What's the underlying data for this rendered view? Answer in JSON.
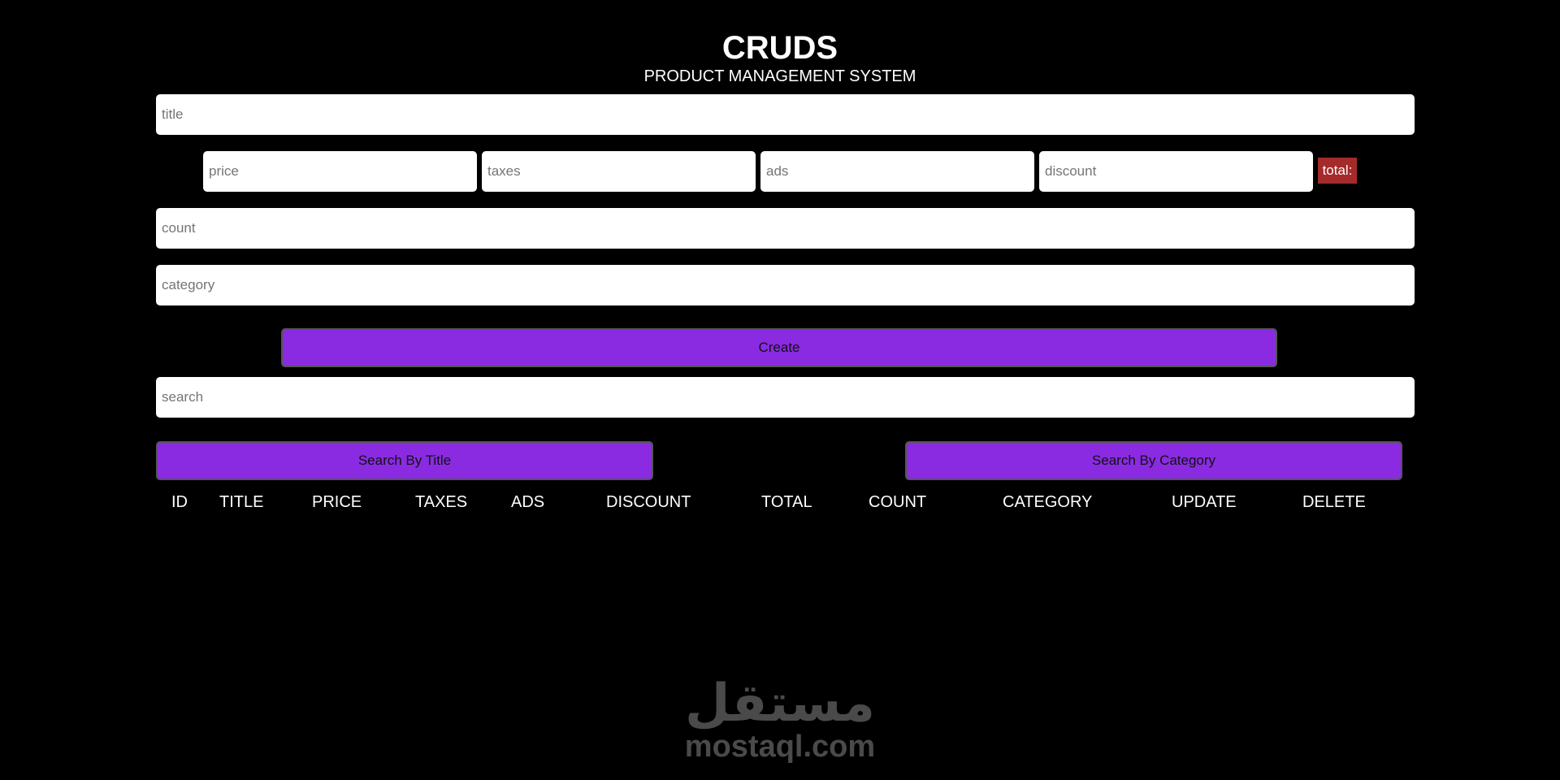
{
  "header": {
    "title": "CRUDS",
    "subtitle": "PRODUCT MANAGEMENT SYSTEM"
  },
  "form": {
    "title_placeholder": "title",
    "price_placeholder": "price",
    "taxes_placeholder": "taxes",
    "ads_placeholder": "ads",
    "discount_placeholder": "discount",
    "total_label": "total:",
    "count_placeholder": "count",
    "category_placeholder": "category",
    "create_label": "Create"
  },
  "search": {
    "placeholder": "search",
    "by_title_label": "Search By Title",
    "by_category_label": "Search By Category"
  },
  "table": {
    "headers": [
      "ID",
      "TITLE",
      "PRICE",
      "TAXES",
      "ADS",
      "DISCOUNT",
      "TOTAL",
      "COUNT",
      "CATEGORY",
      "UPDATE",
      "DELETE"
    ],
    "rows": []
  },
  "colors": {
    "accent": "#8a2be2",
    "total_badge": "#a52a2a",
    "background": "#000000"
  },
  "watermark": {
    "arabic": "مستقل",
    "latin": "mostaql.com"
  }
}
